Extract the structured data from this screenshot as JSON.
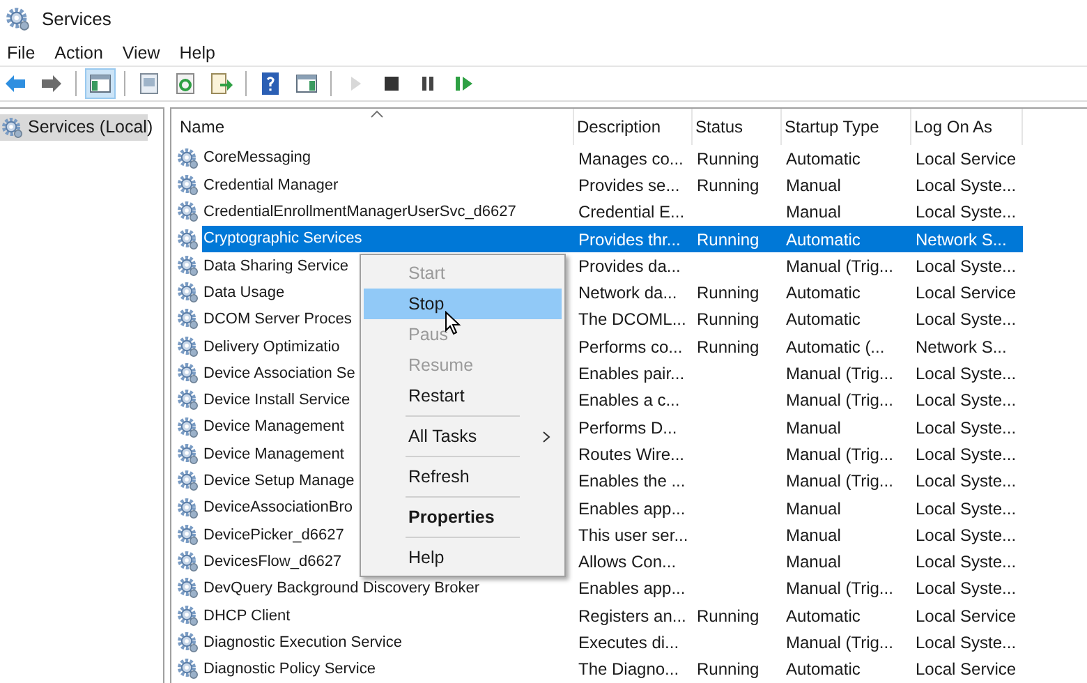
{
  "window": {
    "title": "Services"
  },
  "menu_bar": [
    "File",
    "Action",
    "View",
    "Help"
  ],
  "toolbar": [
    {
      "kind": "back",
      "pressed": false,
      "disabled": false
    },
    {
      "kind": "forward",
      "pressed": false,
      "disabled": false
    },
    {
      "kind": "separator"
    },
    {
      "kind": "console-tree",
      "pressed": true,
      "disabled": false
    },
    {
      "kind": "separator"
    },
    {
      "kind": "properties",
      "pressed": false,
      "disabled": false
    },
    {
      "kind": "refresh",
      "pressed": false,
      "disabled": false
    },
    {
      "kind": "export",
      "pressed": false,
      "disabled": false
    },
    {
      "kind": "separator"
    },
    {
      "kind": "help",
      "pressed": false,
      "disabled": false
    },
    {
      "kind": "action-pane",
      "pressed": false,
      "disabled": false
    },
    {
      "kind": "separator"
    },
    {
      "kind": "start",
      "pressed": false,
      "disabled": true
    },
    {
      "kind": "stop",
      "pressed": false,
      "disabled": false
    },
    {
      "kind": "pause",
      "pressed": false,
      "disabled": false
    },
    {
      "kind": "resume",
      "pressed": false,
      "disabled": false
    }
  ],
  "tree": {
    "items": [
      {
        "label": "Services (Local)",
        "selected": true
      }
    ]
  },
  "table": {
    "columns": [
      "Name",
      "Description",
      "Status",
      "Startup Type",
      "Log On As"
    ],
    "rows": [
      {
        "name": "CoreMessaging",
        "description": "Manages co...",
        "status": "Running",
        "startup_type": "Automatic",
        "log_on_as": "Local Service",
        "selected": false
      },
      {
        "name": "Credential Manager",
        "description": "Provides se...",
        "status": "Running",
        "startup_type": "Manual",
        "log_on_as": "Local Syste...",
        "selected": false
      },
      {
        "name": "CredentialEnrollmentManagerUserSvc_d6627",
        "description": "Credential E...",
        "status": "",
        "startup_type": "Manual",
        "log_on_as": "Local Syste...",
        "selected": false
      },
      {
        "name": "Cryptographic Services",
        "description": "Provides thr...",
        "status": "Running",
        "startup_type": "Automatic",
        "log_on_as": "Network S...",
        "selected": true
      },
      {
        "name": "Data Sharing Service",
        "description": "Provides da...",
        "status": "",
        "startup_type": "Manual (Trig...",
        "log_on_as": "Local Syste...",
        "selected": false
      },
      {
        "name": "Data Usage",
        "description": "Network da...",
        "status": "Running",
        "startup_type": "Automatic",
        "log_on_as": "Local Service",
        "selected": false
      },
      {
        "name": "DCOM Server Proces",
        "description": "The DCOML...",
        "status": "Running",
        "startup_type": "Automatic",
        "log_on_as": "Local Syste...",
        "selected": false
      },
      {
        "name": "Delivery Optimizatio",
        "description": "Performs co...",
        "status": "Running",
        "startup_type": "Automatic (...",
        "log_on_as": "Network S...",
        "selected": false
      },
      {
        "name": "Device Association Se",
        "description": "Enables pair...",
        "status": "",
        "startup_type": "Manual (Trig...",
        "log_on_as": "Local Syste...",
        "selected": false
      },
      {
        "name": "Device Install Service",
        "description": "Enables a c...",
        "status": "",
        "startup_type": "Manual (Trig...",
        "log_on_as": "Local Syste...",
        "selected": false
      },
      {
        "name": "Device Management",
        "description": "Performs D...",
        "status": "",
        "startup_type": "Manual",
        "log_on_as": "Local Syste...",
        "selected": false
      },
      {
        "name": "Device Management",
        "description": "Routes Wire...",
        "status": "",
        "startup_type": "Manual (Trig...",
        "log_on_as": "Local Syste...",
        "selected": false
      },
      {
        "name": "Device Setup Manage",
        "description": "Enables the ...",
        "status": "",
        "startup_type": "Manual (Trig...",
        "log_on_as": "Local Syste...",
        "selected": false
      },
      {
        "name": "DeviceAssociationBro",
        "description": "Enables app...",
        "status": "",
        "startup_type": "Manual",
        "log_on_as": "Local Syste...",
        "selected": false
      },
      {
        "name": "DevicePicker_d6627",
        "description": "This user ser...",
        "status": "",
        "startup_type": "Manual",
        "log_on_as": "Local Syste...",
        "selected": false
      },
      {
        "name": "DevicesFlow_d6627",
        "description": "Allows Con...",
        "status": "",
        "startup_type": "Manual",
        "log_on_as": "Local Syste...",
        "selected": false
      },
      {
        "name": "DevQuery Background Discovery Broker",
        "description": "Enables app...",
        "status": "",
        "startup_type": "Manual (Trig...",
        "log_on_as": "Local Syste...",
        "selected": false
      },
      {
        "name": "DHCP Client",
        "description": "Registers an...",
        "status": "Running",
        "startup_type": "Automatic",
        "log_on_as": "Local Service",
        "selected": false
      },
      {
        "name": "Diagnostic Execution Service",
        "description": "Executes di...",
        "status": "",
        "startup_type": "Manual (Trig...",
        "log_on_as": "Local Syste...",
        "selected": false
      },
      {
        "name": "Diagnostic Policy Service",
        "description": "The Diagno...",
        "status": "Running",
        "startup_type": "Automatic",
        "log_on_as": "Local Service",
        "selected": false
      }
    ]
  },
  "context_menu": {
    "items": [
      {
        "kind": "item",
        "label": "Start",
        "disabled": true,
        "selected": false,
        "default": false,
        "submenu": false
      },
      {
        "kind": "item",
        "label": "Stop",
        "disabled": false,
        "selected": true,
        "default": false,
        "submenu": false
      },
      {
        "kind": "item",
        "label": "Paus",
        "disabled": true,
        "selected": false,
        "default": false,
        "submenu": false
      },
      {
        "kind": "item",
        "label": "Resume",
        "disabled": true,
        "selected": false,
        "default": false,
        "submenu": false
      },
      {
        "kind": "item",
        "label": "Restart",
        "disabled": false,
        "selected": false,
        "default": false,
        "submenu": false
      },
      {
        "kind": "separator"
      },
      {
        "kind": "item",
        "label": "All Tasks",
        "disabled": false,
        "selected": false,
        "default": false,
        "submenu": true
      },
      {
        "kind": "separator"
      },
      {
        "kind": "item",
        "label": "Refresh",
        "disabled": false,
        "selected": false,
        "default": false,
        "submenu": false
      },
      {
        "kind": "separator"
      },
      {
        "kind": "item",
        "label": "Properties",
        "disabled": false,
        "selected": false,
        "default": true,
        "submenu": false
      },
      {
        "kind": "separator"
      },
      {
        "kind": "item",
        "label": "Help",
        "disabled": false,
        "selected": false,
        "default": false,
        "submenu": false
      }
    ]
  }
}
